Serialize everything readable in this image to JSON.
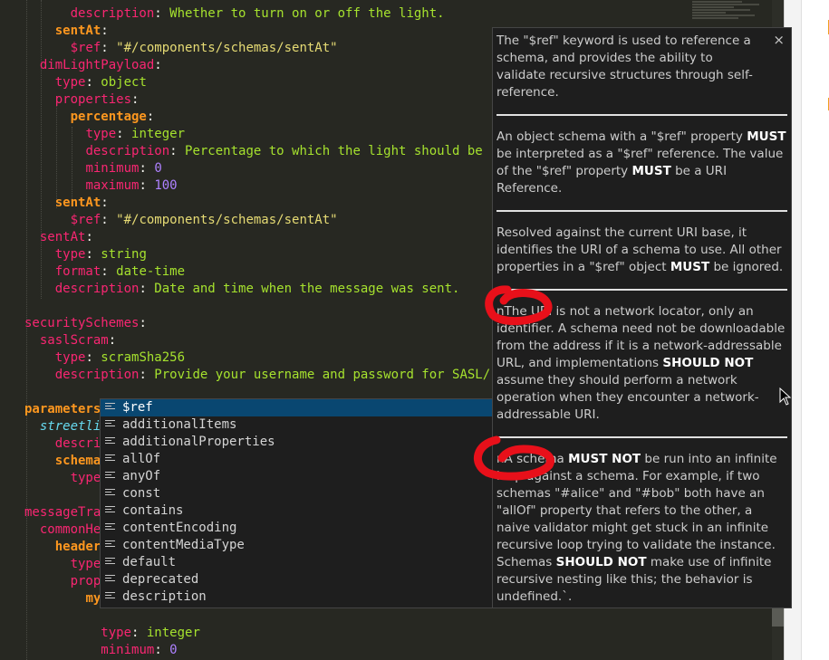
{
  "editor": {
    "lines": [
      {
        "segments": [
          {
            "t": "      ",
            "c": ""
          },
          {
            "t": "description",
            "c": "k"
          },
          {
            "t": ": ",
            "c": ""
          },
          {
            "t": "Whether to turn on or off the light.",
            "c": "v"
          }
        ]
      },
      {
        "segments": [
          {
            "t": "    ",
            "c": ""
          },
          {
            "t": "sentAt",
            "c": "kb"
          },
          {
            "t": ":",
            "c": ""
          }
        ]
      },
      {
        "segments": [
          {
            "t": "      ",
            "c": ""
          },
          {
            "t": "$ref",
            "c": "k"
          },
          {
            "t": ": ",
            "c": ""
          },
          {
            "t": "\"#/components/schemas/sentAt\"",
            "c": "s"
          }
        ]
      },
      {
        "segments": [
          {
            "t": "  ",
            "c": ""
          },
          {
            "t": "dimLightPayload",
            "c": "k"
          },
          {
            "t": ":",
            "c": ""
          }
        ]
      },
      {
        "segments": [
          {
            "t": "    ",
            "c": ""
          },
          {
            "t": "type",
            "c": "k"
          },
          {
            "t": ": ",
            "c": ""
          },
          {
            "t": "object",
            "c": "v"
          }
        ]
      },
      {
        "segments": [
          {
            "t": "    ",
            "c": ""
          },
          {
            "t": "properties",
            "c": "k"
          },
          {
            "t": ":",
            "c": ""
          }
        ]
      },
      {
        "segments": [
          {
            "t": "      ",
            "c": ""
          },
          {
            "t": "percentage",
            "c": "kb"
          },
          {
            "t": ":",
            "c": ""
          }
        ]
      },
      {
        "segments": [
          {
            "t": "        ",
            "c": ""
          },
          {
            "t": "type",
            "c": "k"
          },
          {
            "t": ": ",
            "c": ""
          },
          {
            "t": "integer",
            "c": "v"
          }
        ]
      },
      {
        "segments": [
          {
            "t": "        ",
            "c": ""
          },
          {
            "t": "description",
            "c": "k"
          },
          {
            "t": ": ",
            "c": ""
          },
          {
            "t": "Percentage to which the light should be",
            "c": "v"
          }
        ]
      },
      {
        "segments": [
          {
            "t": "        ",
            "c": ""
          },
          {
            "t": "minimum",
            "c": "k"
          },
          {
            "t": ": ",
            "c": ""
          },
          {
            "t": "0",
            "c": "n"
          }
        ]
      },
      {
        "segments": [
          {
            "t": "        ",
            "c": ""
          },
          {
            "t": "maximum",
            "c": "k"
          },
          {
            "t": ": ",
            "c": ""
          },
          {
            "t": "100",
            "c": "n"
          }
        ]
      },
      {
        "segments": [
          {
            "t": "    ",
            "c": ""
          },
          {
            "t": "sentAt",
            "c": "kb"
          },
          {
            "t": ":",
            "c": ""
          }
        ]
      },
      {
        "segments": [
          {
            "t": "      ",
            "c": ""
          },
          {
            "t": "$ref",
            "c": "k"
          },
          {
            "t": ": ",
            "c": ""
          },
          {
            "t": "\"#/components/schemas/sentAt\"",
            "c": "s"
          }
        ]
      },
      {
        "segments": [
          {
            "t": "  ",
            "c": ""
          },
          {
            "t": "sentAt",
            "c": "k"
          },
          {
            "t": ":",
            "c": ""
          }
        ]
      },
      {
        "segments": [
          {
            "t": "    ",
            "c": ""
          },
          {
            "t": "type",
            "c": "k"
          },
          {
            "t": ": ",
            "c": ""
          },
          {
            "t": "string",
            "c": "v"
          }
        ]
      },
      {
        "segments": [
          {
            "t": "    ",
            "c": ""
          },
          {
            "t": "format",
            "c": "k"
          },
          {
            "t": ": ",
            "c": ""
          },
          {
            "t": "date-time",
            "c": "v"
          }
        ]
      },
      {
        "segments": [
          {
            "t": "    ",
            "c": ""
          },
          {
            "t": "description",
            "c": "k"
          },
          {
            "t": ": ",
            "c": ""
          },
          {
            "t": "Date and time when the message was sent.",
            "c": "v"
          }
        ]
      },
      {
        "segments": []
      },
      {
        "segments": [
          {
            "t": "securitySchemes",
            "c": "k"
          },
          {
            "t": ":",
            "c": ""
          }
        ]
      },
      {
        "segments": [
          {
            "t": "  ",
            "c": ""
          },
          {
            "t": "saslScram",
            "c": "k"
          },
          {
            "t": ":",
            "c": ""
          }
        ]
      },
      {
        "segments": [
          {
            "t": "    ",
            "c": ""
          },
          {
            "t": "type",
            "c": "k"
          },
          {
            "t": ": ",
            "c": ""
          },
          {
            "t": "scramSha256",
            "c": "v"
          }
        ]
      },
      {
        "segments": [
          {
            "t": "    ",
            "c": ""
          },
          {
            "t": "description",
            "c": "k"
          },
          {
            "t": ": ",
            "c": ""
          },
          {
            "t": "Provide your username and password for SASL/",
            "c": "v"
          }
        ]
      },
      {
        "segments": []
      },
      {
        "segments": [
          {
            "t": "parameters",
            "c": "kb"
          }
        ]
      },
      {
        "segments": [
          {
            "t": "  ",
            "c": ""
          },
          {
            "t": "streetli",
            "c": "ki"
          }
        ]
      },
      {
        "segments": [
          {
            "t": "    ",
            "c": ""
          },
          {
            "t": "descri",
            "c": "k"
          }
        ]
      },
      {
        "segments": [
          {
            "t": "    ",
            "c": ""
          },
          {
            "t": "schema",
            "c": "kb"
          }
        ]
      },
      {
        "segments": [
          {
            "t": "      ",
            "c": ""
          },
          {
            "t": "type",
            "c": "k"
          }
        ]
      },
      {
        "segments": []
      },
      {
        "segments": [
          {
            "t": "messageTra",
            "c": "k"
          }
        ]
      },
      {
        "segments": [
          {
            "t": "  ",
            "c": ""
          },
          {
            "t": "commonHe",
            "c": "k"
          }
        ]
      },
      {
        "segments": [
          {
            "t": "    ",
            "c": ""
          },
          {
            "t": "header",
            "c": "kb"
          }
        ]
      },
      {
        "segments": [
          {
            "t": "      ",
            "c": ""
          },
          {
            "t": "type",
            "c": "k"
          }
        ]
      },
      {
        "segments": [
          {
            "t": "      ",
            "c": ""
          },
          {
            "t": "prop",
            "c": "k"
          }
        ]
      },
      {
        "segments": [
          {
            "t": "        ",
            "c": ""
          },
          {
            "t": "my",
            "c": "kb"
          }
        ]
      },
      {
        "segments": []
      },
      {
        "segments": [
          {
            "t": "          ",
            "c": ""
          },
          {
            "t": "type",
            "c": "k"
          },
          {
            "t": ": ",
            "c": ""
          },
          {
            "t": "integer",
            "c": "v"
          }
        ]
      },
      {
        "segments": [
          {
            "t": "          ",
            "c": ""
          },
          {
            "t": "minimum",
            "c": "k"
          },
          {
            "t": ": ",
            "c": ""
          },
          {
            "t": "0",
            "c": "n"
          }
        ]
      }
    ]
  },
  "suggestions": {
    "items": [
      "$ref",
      "additionalItems",
      "additionalProperties",
      "allOf",
      "anyOf",
      "const",
      "contains",
      "contentEncoding",
      "contentMediaType",
      "default",
      "deprecated",
      "description"
    ],
    "selected_index": 0
  },
  "doc": {
    "close_label": "×",
    "paragraphs": [
      [
        {
          "t": "The \"$ref\" keyword is used to reference a schema, and provides the ability to validate recursive structures through self-reference."
        }
      ],
      [
        {
          "t": "An object schema with a \"$ref\" property "
        },
        {
          "t": "MUST",
          "b": true
        },
        {
          "t": " be interpreted as a \"$ref\" reference. The value of the \"$ref\" property "
        },
        {
          "t": "MUST",
          "b": true
        },
        {
          "t": " be a URI Reference."
        }
      ],
      [
        {
          "t": "Resolved against the current URI base, it identifies the URI of a schema to use. All other properties in a \"$ref\" object "
        },
        {
          "t": "MUST",
          "b": true
        },
        {
          "t": " be ignored."
        }
      ],
      [
        {
          "t": "nThe URI is not a network locator, only an identifier. A schema need not be downloadable from the address if it is a network-addressable URL, and implementations "
        },
        {
          "t": "SHOULD NOT",
          "b": true
        },
        {
          "t": " assume they should perform a network operation when they encounter a network-addressable URI."
        }
      ],
      [
        {
          "t": "nA schema "
        },
        {
          "t": "MUST NOT",
          "b": true
        },
        {
          "t": " be run into an infinite loop against a schema. For example, if two schemas \"#alice\" and \"#bob\" both have an \"allOf\" property that refers to the other, a naive validator might get stuck in an infinite recursive loop trying to validate the instance. Schemas "
        },
        {
          "t": "SHOULD NOT",
          "b": true
        },
        {
          "t": " make use of infinite recursive nesting like this; the behavior is undefined.`."
        }
      ]
    ]
  },
  "colors": {
    "annotation": "#e8101a",
    "selection": "#094771"
  },
  "icons": {
    "suggestion_item": "text-lines-icon",
    "close": "close-icon",
    "cursor": "mouse-cursor-icon"
  }
}
